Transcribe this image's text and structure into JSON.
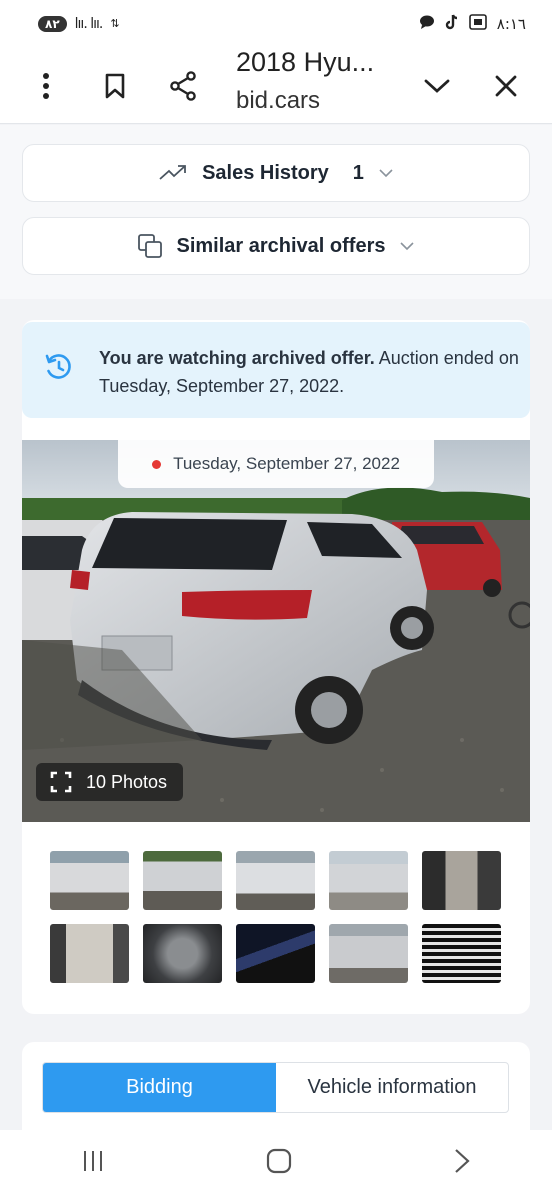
{
  "status_bar": {
    "left_pill": "٨٢",
    "signal": "lıı. lıı.",
    "time": "٨:١٦"
  },
  "header": {
    "title": "2018 Hyu...",
    "domain": "bid.cars",
    "icons": [
      "more-vertical-icon",
      "bookmark-icon",
      "share-icon",
      "chevron-down-icon",
      "close-icon"
    ]
  },
  "sales_history": {
    "label": "Sales History",
    "count": "1"
  },
  "similar_offers": {
    "label": "Similar archival offers"
  },
  "notice": {
    "bold": "You are watching archived offer.",
    "rest": " Auction ended on Tuesday, September 27, 2022."
  },
  "main_photo": {
    "date_label": "Tuesday, September 27, 2022",
    "photos_label": "10 Photos"
  },
  "thumbnails": [
    {
      "desc": "front-damage"
    },
    {
      "desc": "front-damage-2"
    },
    {
      "desc": "rear-view"
    },
    {
      "desc": "rear-view-2"
    },
    {
      "desc": "interior-front"
    },
    {
      "desc": "interior-rear"
    },
    {
      "desc": "engine"
    },
    {
      "desc": "dashboard"
    },
    {
      "desc": "front-closeup"
    },
    {
      "desc": "label-sticker"
    }
  ],
  "tabs": [
    {
      "label": "Bidding",
      "active": true
    },
    {
      "label": "Vehicle information",
      "active": false
    }
  ],
  "colors": {
    "accent": "#2e9af0",
    "notice_bg": "#e4f3fc",
    "red_dot": "#e53935"
  }
}
